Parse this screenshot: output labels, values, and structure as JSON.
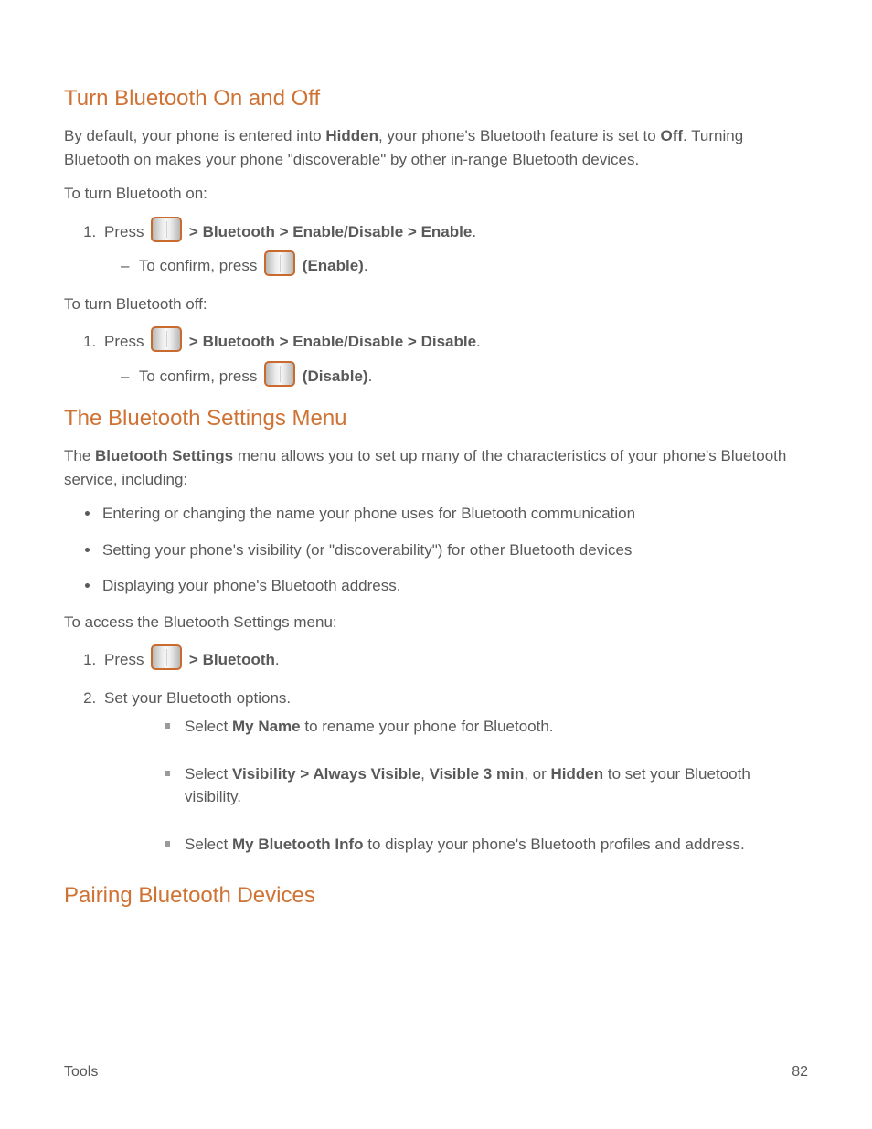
{
  "headings": {
    "turn_on": "Turn Bluetooth On and Off",
    "settings": "The Bluetooth Settings Menu",
    "pair": "Pairing Bluetooth Devices"
  },
  "intro": {
    "p1_a": "By default, your phone is entered into ",
    "p1_bold": "Hidden",
    "p1_b": ", your phone's Bluetooth feature is set to ",
    "p1_bold2": "Off",
    "p1_c": ". Turning Bluetooth on makes your phone \"discoverable\" by other in-range Bluetooth devices.",
    "enable_label": "To turn Bluetooth on:",
    "disable_label": "To turn Bluetooth off:"
  },
  "steps": {
    "press_a": "Press ",
    "menu_path": " > Bluetooth > Enable/Disable > Enable",
    "confirm_a": "To confirm, press ",
    "enable_key": " (Enable)",
    "disable_key": " (Disable)",
    "menu_path2": " > Bluetooth > Enable/Disable > Disable"
  },
  "settings_intro_a": "The ",
  "settings_intro_bold": "Bluetooth Settings",
  "settings_intro_b": " menu allows you to set up many of the characteristics of your phone's Bluetooth service, including:",
  "bullets": {
    "b1": "Entering or changing the name your phone uses for Bluetooth communication",
    "b2": "Setting your phone's visibility (or \"discoverability\") for other Bluetooth devices",
    "b3": "Displaying your phone's Bluetooth address."
  },
  "access_label": "To access the Bluetooth Settings menu:",
  "access_step1_a": "Press ",
  "access_step1_path": " > Bluetooth",
  "access_step2": "Set your Bluetooth options.",
  "opts": {
    "o1_a": "Select ",
    "o1_bold": "My Name",
    "o1_b": " to rename your phone for Bluetooth.",
    "o2_a": "Select ",
    "o2_bold1": "Visibility > Always Visible",
    "o2_mid": ", ",
    "o2_bold2": "Visible 3 min",
    "o2_mid2": ", or ",
    "o2_bold3": "Hidden",
    "o2_end": " to set your Bluetooth visibility.",
    "o3_a": "Select ",
    "o3_bold": "My Bluetooth Info",
    "o3_b": " to display your phone's Bluetooth profiles and address."
  },
  "footer": {
    "left": "Tools",
    "right": "82"
  }
}
